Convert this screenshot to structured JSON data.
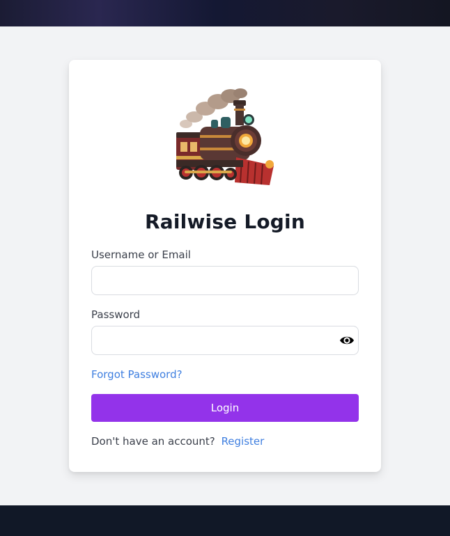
{
  "header": {},
  "login": {
    "logo_icon": "steam-locomotive-logo",
    "title": "Railwise Login",
    "username_label": "Username or Email",
    "username_value": "",
    "password_label": "Password",
    "password_value": "",
    "show_password_icon": "eye-icon",
    "forgot_password": "Forgot Password?",
    "login_button": "Login",
    "register_prompt": "Don't have an account?",
    "register_link": "Register"
  },
  "colors": {
    "page_background": "#f2f3f5",
    "card_background": "#ffffff",
    "primary_button": "#9333ea",
    "link": "#3f7fe0",
    "title_text": "#141a26",
    "footer": "#111827"
  }
}
